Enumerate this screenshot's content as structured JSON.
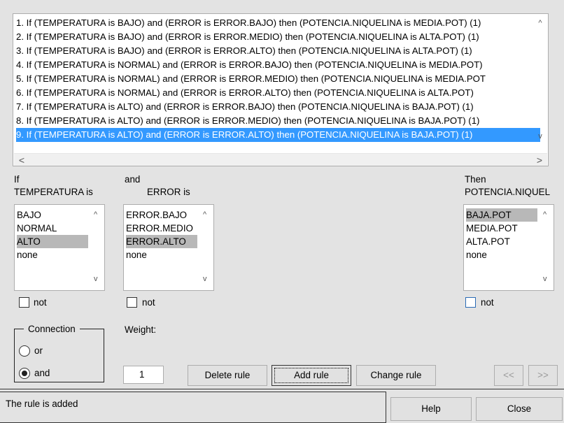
{
  "rules": [
    "1. If (TEMPERATURA is BAJO) and (ERROR is ERROR.BAJO) then (POTENCIA.NIQUELINA is MEDIA.POT) (1)",
    "2. If (TEMPERATURA is BAJO) and (ERROR is ERROR.MEDIO) then (POTENCIA.NIQUELINA is ALTA.POT) (1)",
    "3. If (TEMPERATURA is BAJO) and (ERROR is ERROR.ALTO) then (POTENCIA.NIQUELINA is ALTA.POT) (1)",
    "4. If (TEMPERATURA is NORMAL) and (ERROR is ERROR.BAJO) then (POTENCIA.NIQUELINA is MEDIA.POT)",
    "5. If (TEMPERATURA is NORMAL) and (ERROR is ERROR.MEDIO) then (POTENCIA.NIQUELINA is MEDIA.POT",
    "6. If (TEMPERATURA is NORMAL) and (ERROR is ERROR.ALTO) then (POTENCIA.NIQUELINA is ALTA.POT)",
    "7. If (TEMPERATURA is ALTO) and (ERROR is ERROR.BAJO) then (POTENCIA.NIQUELINA is BAJA.POT) (1)",
    "8. If (TEMPERATURA is ALTO) and (ERROR is ERROR.MEDIO) then (POTENCIA.NIQUELINA is BAJA.POT) (1)",
    "9. If (TEMPERATURA is ALTO) and (ERROR is ERROR.ALTO) then (POTENCIA.NIQUELINA is BAJA.POT) (1)"
  ],
  "selected_rule_index": 8,
  "input1": {
    "prefix": "If",
    "name": "TEMPERATURA is",
    "options": [
      "BAJO",
      "NORMAL",
      "ALTO",
      "none"
    ],
    "selected_index": 2,
    "not_label": "not"
  },
  "input2": {
    "prefix": "and",
    "name": "ERROR is",
    "options": [
      "ERROR.BAJO",
      "ERROR.MEDIO",
      "ERROR.ALTO",
      "none"
    ],
    "selected_index": 2,
    "not_label": "not"
  },
  "output": {
    "prefix": "Then",
    "name": "POTENCIA.NIQUEL",
    "options": [
      "BAJA.POT",
      "MEDIA.POT",
      "ALTA.POT",
      "none"
    ],
    "selected_index": 0,
    "not_label": "not"
  },
  "connection": {
    "title": "Connection",
    "or_label": "or",
    "and_label": "and",
    "selected": "and"
  },
  "weight": {
    "label": "Weight:",
    "value": "1"
  },
  "buttons": {
    "delete": "Delete rule",
    "add": "Add rule",
    "change": "Change rule",
    "prev": "<<",
    "next": ">>",
    "help": "Help",
    "close": "Close"
  },
  "status": "The rule is added"
}
